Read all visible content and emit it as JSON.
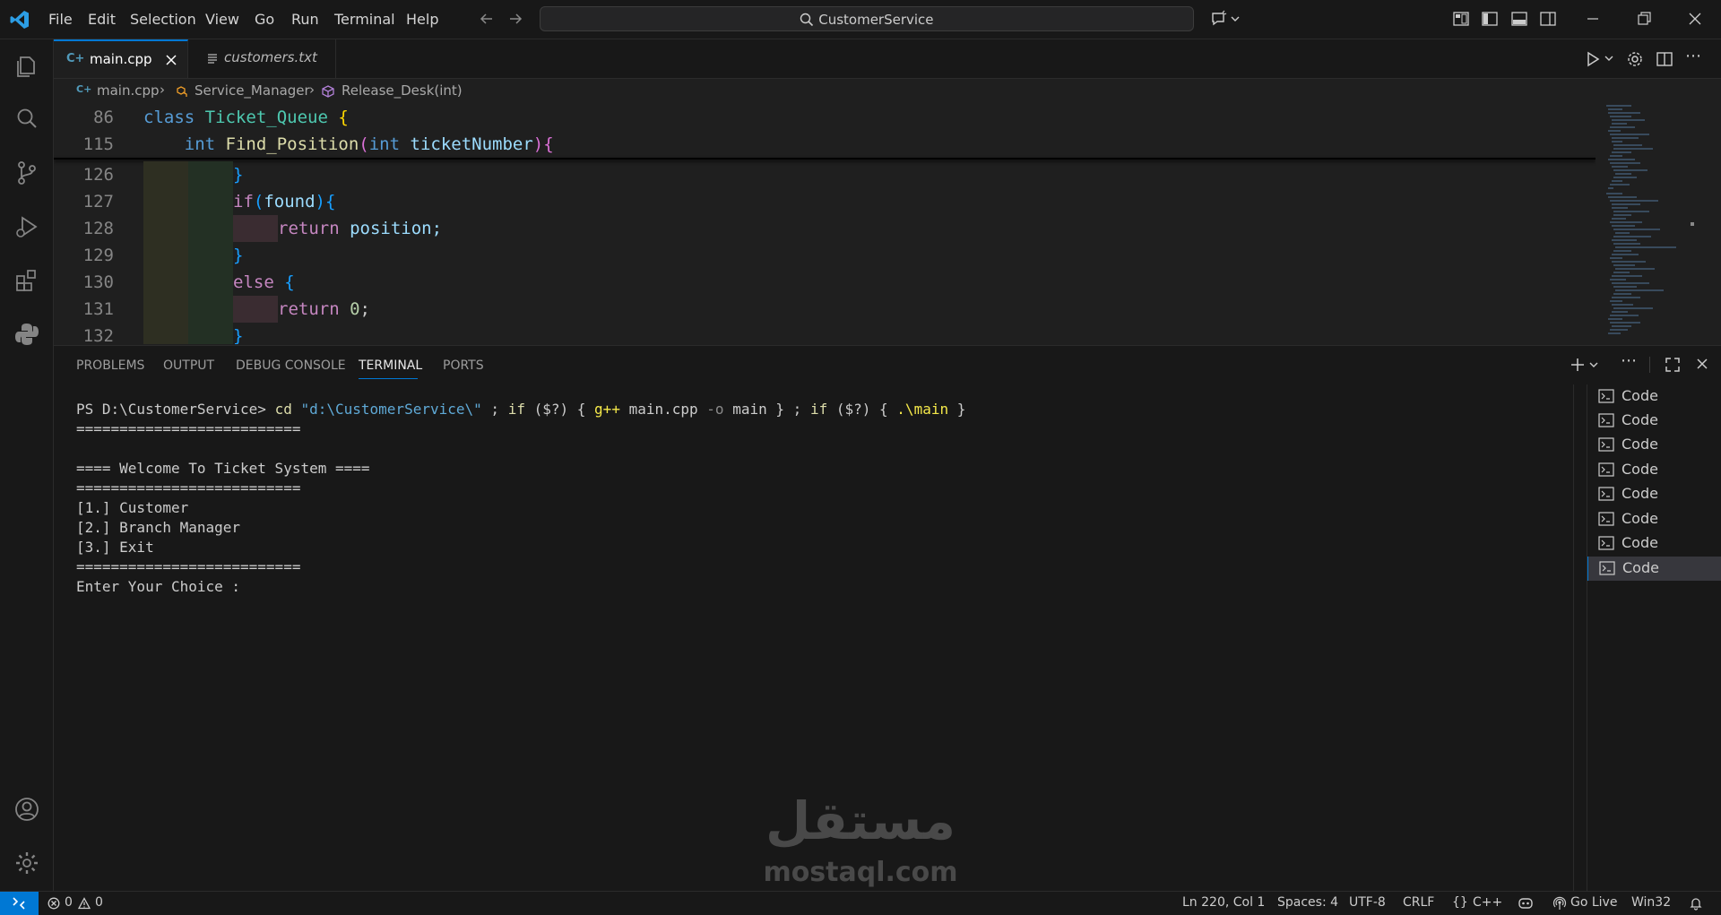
{
  "titlebar": {
    "menus": [
      "File",
      "Edit",
      "Selection",
      "View",
      "Go",
      "Run",
      "Terminal",
      "Help"
    ],
    "search": "CustomerService"
  },
  "tabs": [
    {
      "label": "main.cpp",
      "active": true
    },
    {
      "label": "customers.txt",
      "active": false
    }
  ],
  "breadcrumb": {
    "file": "main.cpp",
    "class": "Service_Manager",
    "method": "Release_Desk(int)"
  },
  "editor": {
    "sticky": [
      {
        "num": "86",
        "kw": "class",
        "name": "Ticket_Queue",
        "brace": "{"
      },
      {
        "num": "115",
        "type": "int",
        "fn": "Find_Position",
        "open": "(",
        "ptype": "int",
        "param": "ticketNumber",
        "close": ")",
        "brace": "{"
      }
    ],
    "lines": [
      {
        "num": "126",
        "text": "}"
      },
      {
        "num": "127",
        "kw": "if",
        "open": "(",
        "var": "found",
        "close": ")",
        "brace": "{"
      },
      {
        "num": "128",
        "kw": "return",
        "var": "position;"
      },
      {
        "num": "129",
        "text": "}"
      },
      {
        "num": "130",
        "kw": "else",
        "brace": "{"
      },
      {
        "num": "131",
        "kw": "return",
        "num_val": "0",
        "semi": ";"
      },
      {
        "num": "132",
        "text": "}"
      }
    ]
  },
  "panel": {
    "tabs": [
      "PROBLEMS",
      "OUTPUT",
      "DEBUG CONSOLE",
      "TERMINAL",
      "PORTS"
    ],
    "active_tab": "TERMINAL",
    "terminal": {
      "prompt": "PS D:\\CustomerService>",
      "cmd": "cd",
      "path": "\"d:\\CustomerService\\\"",
      "semi1": ";",
      "if1": "if",
      "cond1": "($?)",
      "open1": "{",
      "gpp": "g++",
      "args": "main.cpp",
      "flag": "-o",
      "out": "main",
      "close1": "}",
      "semi2": ";",
      "if2": "if",
      "cond2": "($?)",
      "open2": "{",
      "exe": ".\\main",
      "close2": "}",
      "output": [
        "==========================",
        "",
        "==== Welcome To Ticket System ====",
        "==========================",
        "[1.] Customer",
        "[2.] Branch Manager",
        "[3.] Exit",
        "==========================",
        "Enter Your Choice :"
      ]
    },
    "terminals": [
      "Code",
      "Code",
      "Code",
      "Code",
      "Code",
      "Code",
      "Code",
      "Code"
    ]
  },
  "statusbar": {
    "errors": "0",
    "warnings": "0",
    "position": "Ln 220, Col 1",
    "spaces": "Spaces: 4",
    "encoding": "UTF-8",
    "eol": "CRLF",
    "language": "C++",
    "golive": "Go Live",
    "platform": "Win32"
  },
  "watermark": {
    "arabic": "مستقل",
    "latin": "mostaql.com"
  },
  "colors": {
    "accent": "#0078d4",
    "background": "#1f1f1f",
    "panel": "#181818"
  }
}
